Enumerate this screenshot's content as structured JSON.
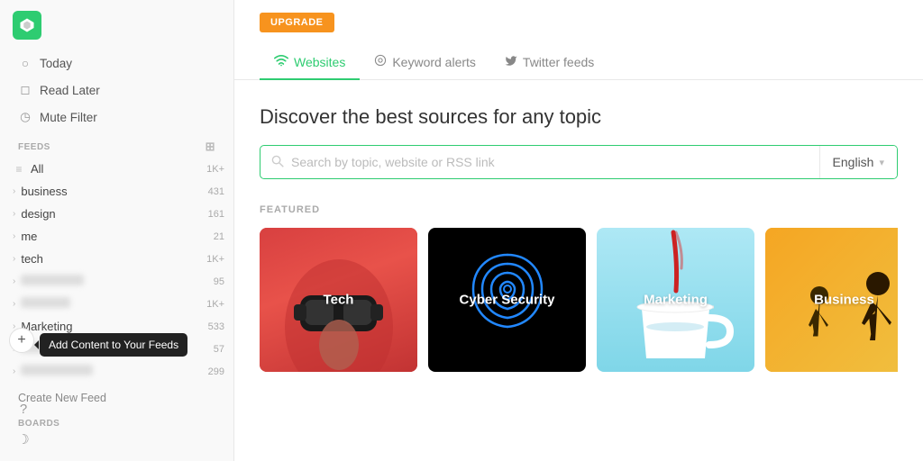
{
  "sidebar": {
    "nav": [
      {
        "id": "today",
        "label": "Today",
        "icon": "○"
      },
      {
        "id": "read-later",
        "label": "Read Later",
        "icon": "◻"
      },
      {
        "id": "mute-filter",
        "label": "Mute Filter",
        "icon": "◷"
      }
    ],
    "feeds_label": "FEEDS",
    "feeds": [
      {
        "id": "all",
        "label": "All",
        "count": "1K+",
        "icon": "≡",
        "indent": false
      },
      {
        "id": "business",
        "label": "business",
        "count": "431",
        "icon": "›",
        "indent": true
      },
      {
        "id": "design",
        "label": "design",
        "count": "161",
        "icon": "›",
        "indent": true
      },
      {
        "id": "me",
        "label": "me",
        "count": "21",
        "icon": "›",
        "indent": true
      },
      {
        "id": "tech",
        "label": "tech",
        "count": "1K+",
        "icon": "›",
        "indent": true
      },
      {
        "id": "blurred1",
        "label": "",
        "count": "95",
        "icon": "›",
        "indent": true,
        "blurred": true
      },
      {
        "id": "blurred2",
        "label": "",
        "count": "1K+",
        "icon": "›",
        "indent": true,
        "blurred": true
      },
      {
        "id": "marketing",
        "label": "Marketing",
        "count": "533",
        "icon": "›",
        "indent": true
      },
      {
        "id": "blurred3",
        "label": "",
        "count": "57",
        "icon": "›",
        "indent": true,
        "blurred": true
      },
      {
        "id": "blurred4",
        "label": "",
        "count": "299",
        "icon": "›",
        "indent": true,
        "blurred": true
      }
    ],
    "create_feed": "Create New Feed",
    "boards_label": "BOARDS",
    "tooltip": "Add Content to Your Feeds"
  },
  "header": {
    "upgrade_label": "UPGRADE",
    "tabs": [
      {
        "id": "websites",
        "label": "Websites",
        "icon": "wifi",
        "active": true
      },
      {
        "id": "keyword-alerts",
        "label": "Keyword alerts",
        "icon": "circle",
        "active": false
      },
      {
        "id": "twitter-feeds",
        "label": "Twitter feeds",
        "icon": "bird",
        "active": false
      }
    ]
  },
  "discover": {
    "title": "Discover the best sources for any topic",
    "search_placeholder": "Search by topic, website or RSS link",
    "language": "English",
    "featured_label": "FEATURED",
    "cards": [
      {
        "id": "tech",
        "label": "Tech",
        "theme": "tech"
      },
      {
        "id": "cyber",
        "label": "Cyber Security",
        "theme": "cyber"
      },
      {
        "id": "marketing",
        "label": "Marketing",
        "theme": "marketing"
      },
      {
        "id": "business",
        "label": "Business",
        "theme": "business"
      }
    ]
  }
}
